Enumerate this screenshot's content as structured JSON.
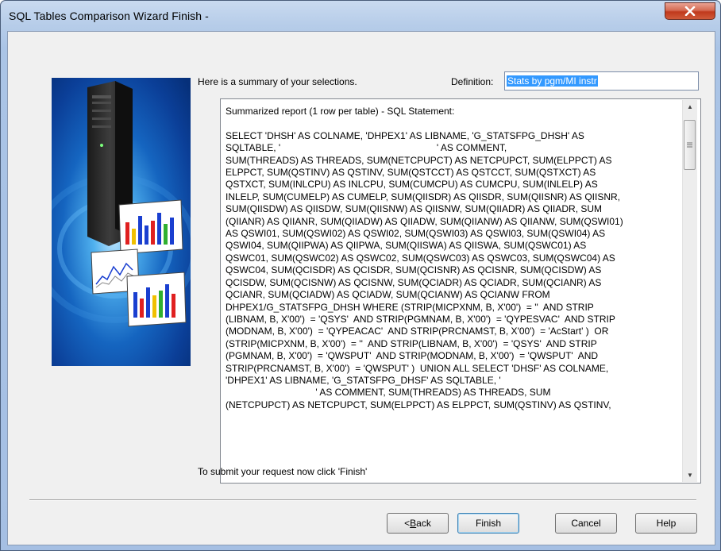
{
  "window": {
    "title": "SQL Tables Comparison Wizard Finish -"
  },
  "illustration": {
    "icon": "server-with-charts-illustration"
  },
  "summary_label": "Here is a summary of your selections.",
  "definition": {
    "label": "Definition:",
    "value": "Stats by pgm/MI instr"
  },
  "report": {
    "lines": [
      "Summarized report (1 row per table) - SQL Statement:",
      "",
      "SELECT 'DHSH' AS COLNAME, 'DHPEX1' AS LIBNAME, 'G_STATSFPG_DHSH' AS",
      "SQLTABLE, '                                                           ' AS COMMENT,",
      "SUM(THREADS) AS THREADS, SUM(NETCPUPCT) AS NETCPUPCT, SUM(ELPPCT) AS",
      "ELPPCT, SUM(QSTINV) AS QSTINV, SUM(QSTCCT) AS QSTCCT, SUM(QSTXCT) AS",
      "QSTXCT, SUM(INLCPU) AS INLCPU, SUM(CUMCPU) AS CUMCPU, SUM(INLELP) AS",
      "INLELP, SUM(CUMELP) AS CUMELP, SUM(QIISDR) AS QIISDR, SUM(QIISNR) AS QIISNR,",
      "SUM(QIISDW) AS QIISDW, SUM(QIISNW) AS QIISNW, SUM(QIIADR) AS QIIADR, SUM",
      "(QIIANR) AS QIIANR, SUM(QIIADW) AS QIIADW, SUM(QIIANW) AS QIIANW, SUM(QSWI01)",
      "AS QSWI01, SUM(QSWI02) AS QSWI02, SUM(QSWI03) AS QSWI03, SUM(QSWI04) AS",
      "QSWI04, SUM(QIIPWA) AS QIIPWA, SUM(QIISWA) AS QIISWA, SUM(QSWC01) AS",
      "QSWC01, SUM(QSWC02) AS QSWC02, SUM(QSWC03) AS QSWC03, SUM(QSWC04) AS",
      "QSWC04, SUM(QCISDR) AS QCISDR, SUM(QCISNR) AS QCISNR, SUM(QCISDW) AS",
      "QCISDW, SUM(QCISNW) AS QCISNW, SUM(QCIADR) AS QCIADR, SUM(QCIANR) AS",
      "QCIANR, SUM(QCIADW) AS QCIADW, SUM(QCIANW) AS QCIANW FROM",
      "DHPEX1/G_STATSFPG_DHSH WHERE (STRIP(MICPXNM, B, X'00')  = ''  AND STRIP",
      "(LIBNAM, B, X'00')  = 'QSYS'  AND STRIP(PGMNAM, B, X'00')  = 'QYPESVAC'  AND STRIP",
      "(MODNAM, B, X'00')  = 'QYPEACAC'  AND STRIP(PRCNAMST, B, X'00')  = 'AcStart' )  OR",
      "(STRIP(MICPXNM, B, X'00')  = ''  AND STRIP(LIBNAM, B, X'00')  = 'QSYS'  AND STRIP",
      "(PGMNAM, B, X'00')  = 'QWSPUT'  AND STRIP(MODNAM, B, X'00')  = 'QWSPUT'  AND",
      "STRIP(PRCNAMST, B, X'00')  = 'QWSPUT' )  UNION ALL SELECT 'DHSF' AS COLNAME,",
      "'DHPEX1' AS LIBNAME, 'G_STATSFPG_DHSF' AS SQLTABLE, '",
      "                                  ' AS COMMENT, SUM(THREADS) AS THREADS, SUM",
      "(NETCPUPCT) AS NETCPUPCT, SUM(ELPPCT) AS ELPPCT, SUM(QSTINV) AS QSTINV,"
    ]
  },
  "submit_hint": "To submit your request now click 'Finish'",
  "buttons": {
    "back": {
      "underlined": "B",
      "rest": "ack",
      "prefix": "< "
    },
    "finish": "Finish",
    "cancel": "Cancel",
    "help": "Help"
  },
  "colors": {
    "selection": "#3399ff",
    "close_button": "#c9462a",
    "dialog_background": "#f0f0f0"
  }
}
